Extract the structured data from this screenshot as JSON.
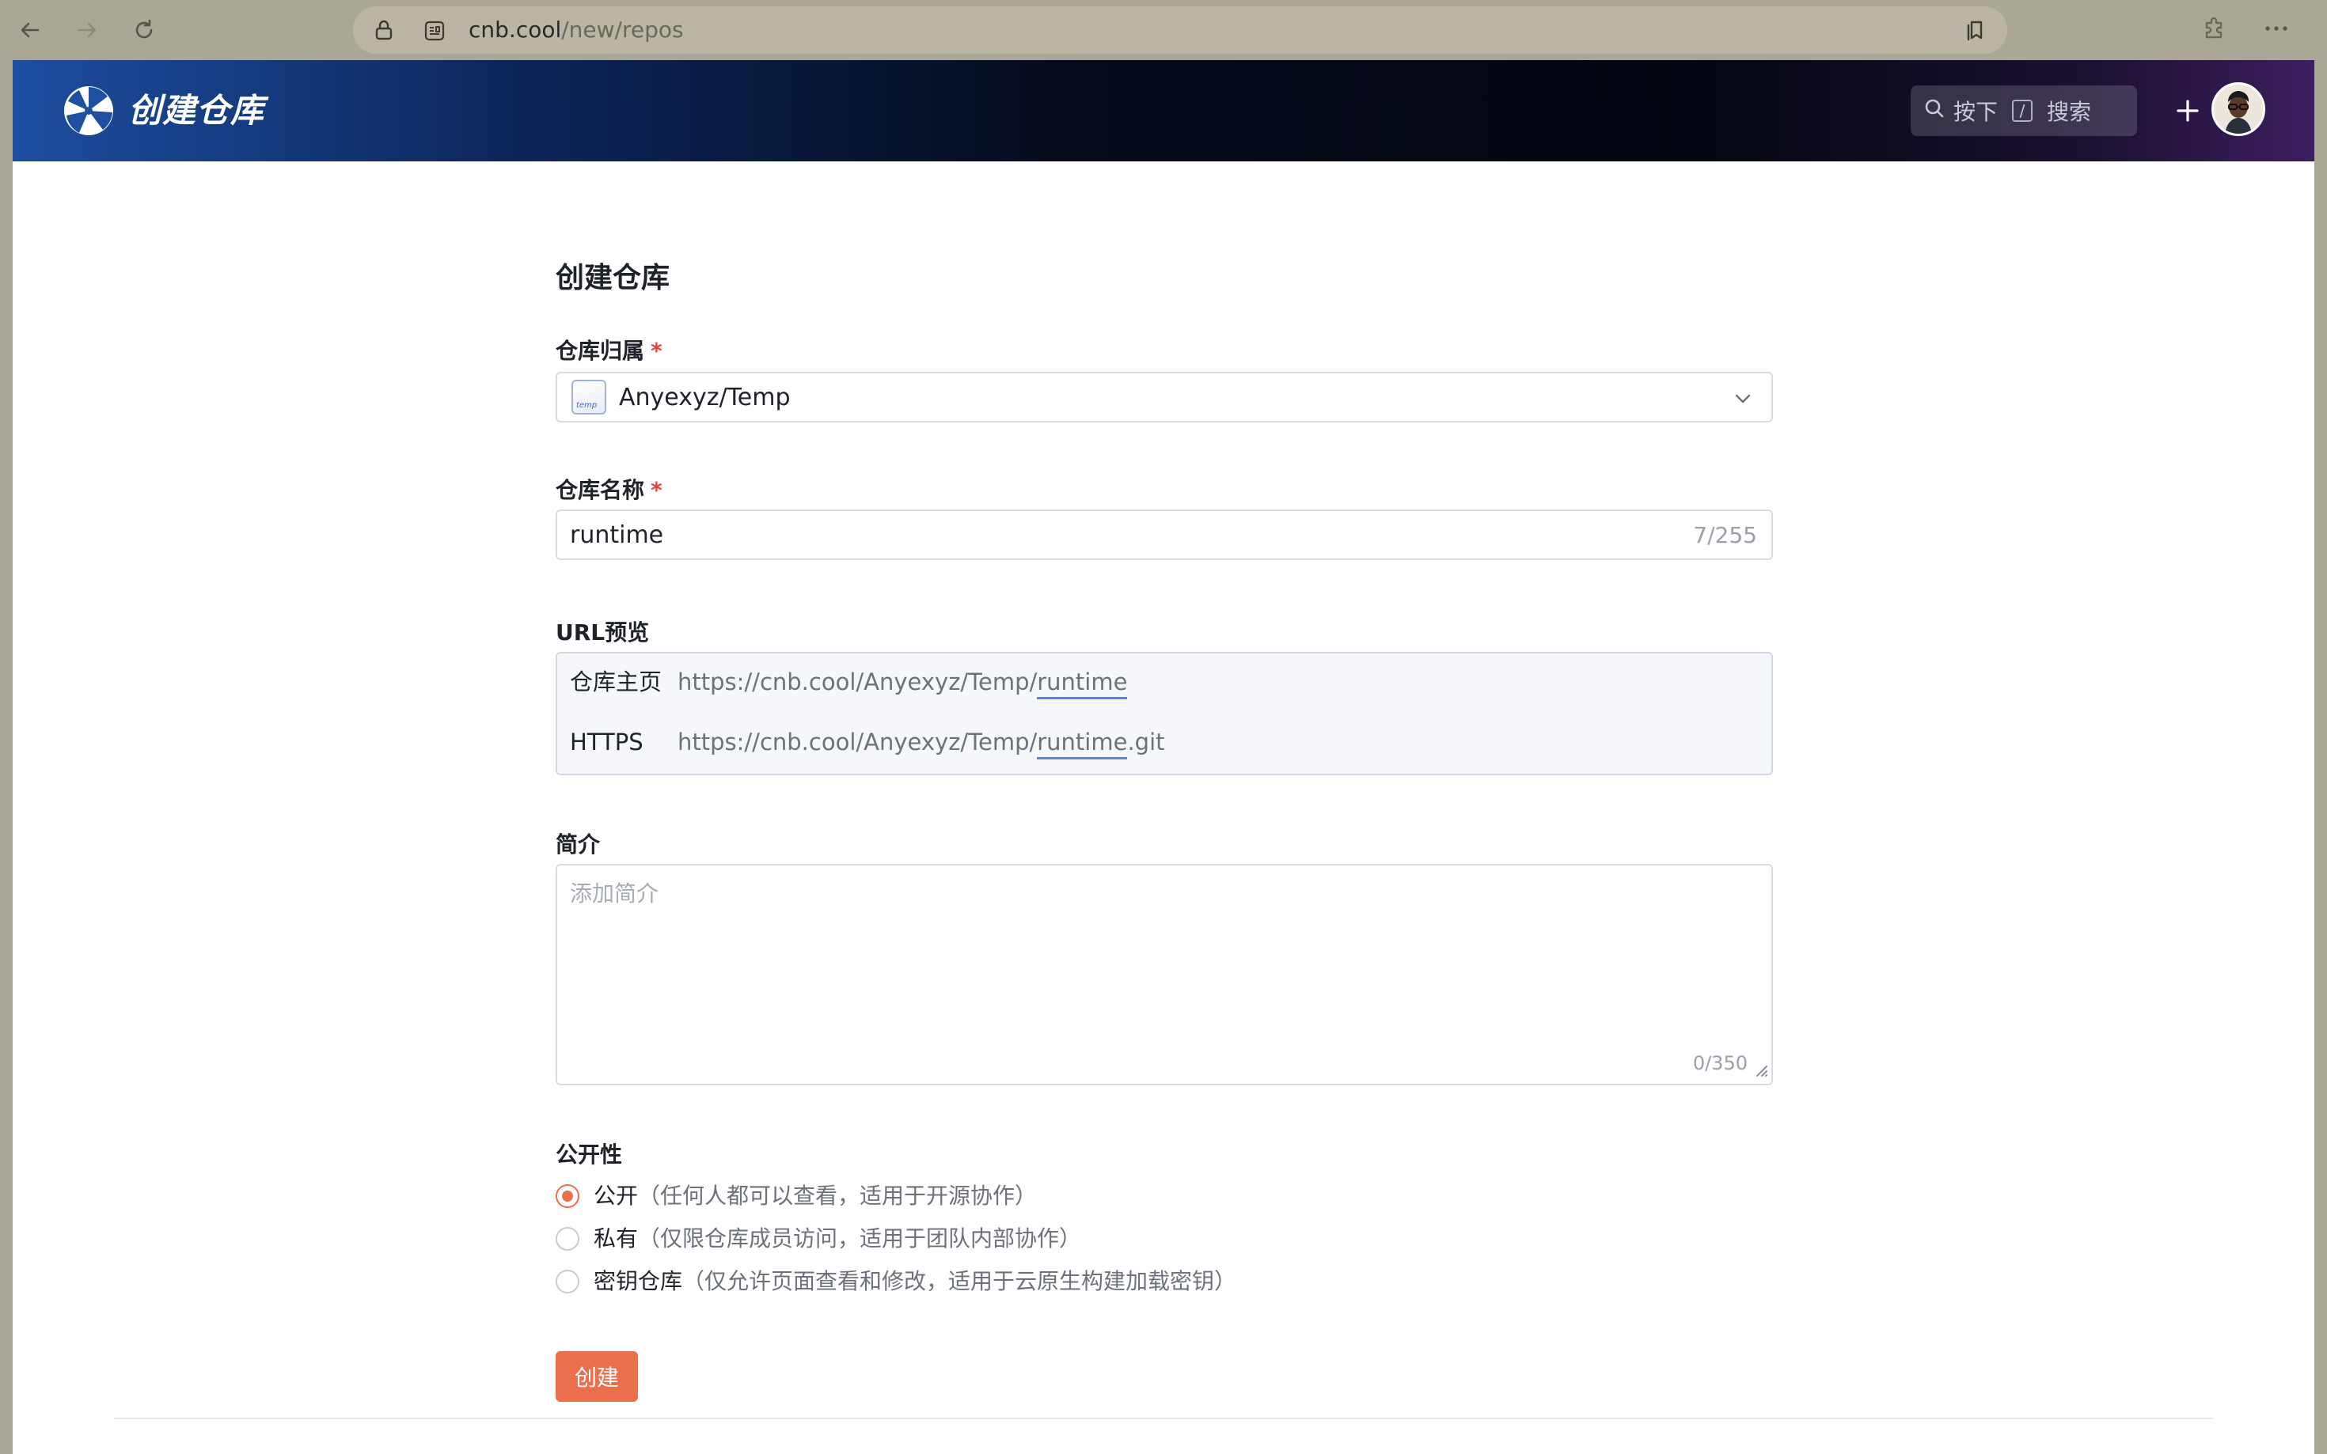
{
  "browser": {
    "url_host": "cnb.cool",
    "url_path": "/new/repos"
  },
  "header": {
    "brand": "创建仓库",
    "search": {
      "press": "按下",
      "key": "/",
      "action": "搜索"
    }
  },
  "form": {
    "title": "创建仓库",
    "owner": {
      "label": "仓库归属",
      "required": "*",
      "value": "Anyexyz/Temp",
      "icon_text": "temp"
    },
    "name": {
      "label": "仓库名称",
      "required": "*",
      "value": "runtime",
      "counter": "7/255"
    },
    "url_preview": {
      "label": "URL预览",
      "home": {
        "key": "仓库主页",
        "prefix": "https://cnb.cool/Anyexyz/Temp/",
        "name": "runtime",
        "suffix": ""
      },
      "https": {
        "key": "HTTPS",
        "prefix": "https://cnb.cool/Anyexyz/Temp/",
        "name": "runtime",
        "suffix": ".git"
      }
    },
    "description": {
      "label": "简介",
      "placeholder": "添加简介",
      "counter": "0/350"
    },
    "visibility": {
      "label": "公开性",
      "options": [
        {
          "name": "公开",
          "desc": "（任何人都可以查看，适用于开源协作）",
          "selected": true
        },
        {
          "name": "私有",
          "desc": "（仅限仓库成员访问，适用于团队内部协作）",
          "selected": false
        },
        {
          "name": "密钥仓库",
          "desc": "（仅允许页面查看和修改，适用于云原生构建加载密钥）",
          "selected": false
        }
      ]
    },
    "submit_label": "创建"
  },
  "colors": {
    "accent": "#ec6f4b",
    "link_underline": "#5a85d6"
  }
}
